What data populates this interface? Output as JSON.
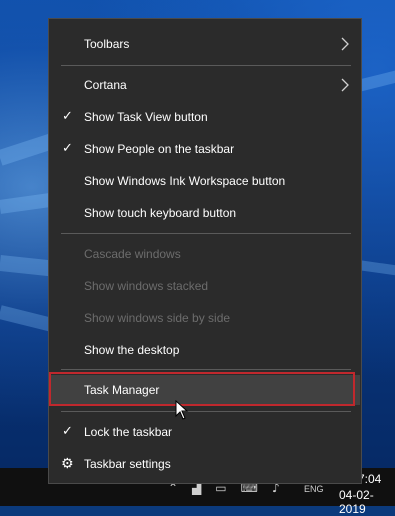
{
  "menu": {
    "items": [
      {
        "label": "Toolbars",
        "checked": false,
        "disabled": false,
        "submenu": true
      },
      {
        "label": "Cortana",
        "checked": false,
        "disabled": false,
        "submenu": true
      },
      {
        "label": "Show Task View button",
        "checked": true,
        "disabled": false,
        "submenu": false
      },
      {
        "label": "Show People on the taskbar",
        "checked": true,
        "disabled": false,
        "submenu": false
      },
      {
        "label": "Show Windows Ink Workspace button",
        "checked": false,
        "disabled": false,
        "submenu": false
      },
      {
        "label": "Show touch keyboard button",
        "checked": false,
        "disabled": false,
        "submenu": false
      },
      {
        "label": "Cascade windows",
        "checked": false,
        "disabled": true,
        "submenu": false
      },
      {
        "label": "Show windows stacked",
        "checked": false,
        "disabled": true,
        "submenu": false
      },
      {
        "label": "Show windows side by side",
        "checked": false,
        "disabled": true,
        "submenu": false
      },
      {
        "label": "Show the desktop",
        "checked": false,
        "disabled": false,
        "submenu": false
      },
      {
        "label": "Task Manager",
        "checked": false,
        "disabled": false,
        "submenu": false,
        "highlighted": true
      },
      {
        "label": "Lock the taskbar",
        "checked": true,
        "disabled": false,
        "submenu": false
      },
      {
        "label": "Taskbar settings",
        "checked": false,
        "disabled": false,
        "submenu": false,
        "icon": "gear-icon"
      }
    ],
    "check_glyph": "✓",
    "gear_glyph": "⚙"
  },
  "colors": {
    "menu_background": "#2b2b2b",
    "text": "#ffffff",
    "disabled_text": "#6c6c6c",
    "highlight_outline": "#c0282d"
  },
  "taskbar": {
    "time": "7:04",
    "date": "04-02-2019",
    "language": "ENG",
    "tray_icons": [
      "chevron-up-icon",
      "network-icon",
      "battery-icon",
      "keyboard-icon",
      "volume-icon",
      "display-icon"
    ]
  }
}
